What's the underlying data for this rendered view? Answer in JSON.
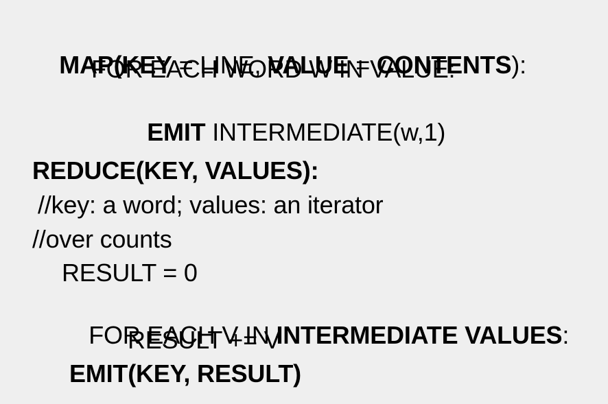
{
  "map": {
    "line1": {
      "map_key": "MAP(KEY",
      "eq1": " = LINE, ",
      "value_kw": "VALUE",
      "eq2": " = ",
      "contents_kw": "CONTENTS",
      "close": "):"
    },
    "line2": "FOR EACH WORD W IN VALUE:",
    "line3": {
      "emit_kw": "EMIT",
      "rest": " INTERMEDIATE(w,1)"
    }
  },
  "reduce": {
    "header": "REDUCE(KEY, VALUES):",
    "comment1": "//key: a word; values: an iterator",
    "comment2": "//over counts",
    "result_init": "RESULT = 0",
    "for_line": {
      "prefix": "FOR EACH V IN ",
      "bold": "INTERMEDIATE VALUES",
      "suffix": ":"
    },
    "accumulate": "RESULT += V",
    "emit": "EMIT(KEY, RESULT)"
  }
}
